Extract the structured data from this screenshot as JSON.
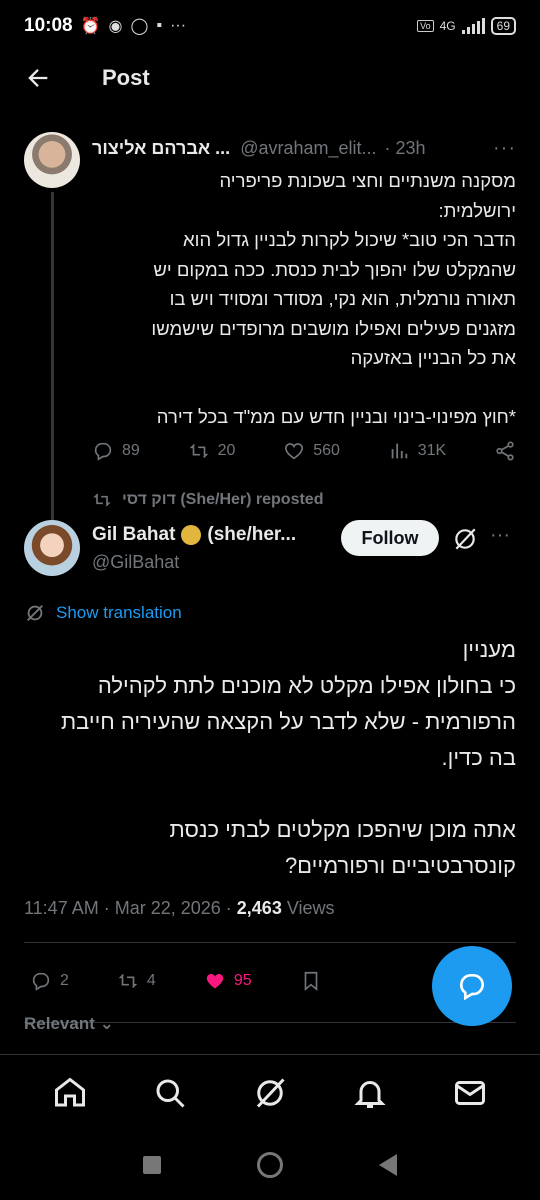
{
  "status_bar": {
    "time": "10:08",
    "network": "4G",
    "battery": "69"
  },
  "header": {
    "title": "Post"
  },
  "original_post": {
    "author_name": "אברהם אליצור ...",
    "handle": "@avraham_elit...",
    "time": "· 23h",
    "lines": [
      "מסקנה משנתיים וחצי בשכונת פריפריה",
      "ירושלמית:",
      "הדבר הכי טוב* שיכול לקרות לבניין גדול הוא",
      "שהמקלט שלו יהפוך לבית כנסת. ככה במקום יש",
      "תאורה נורמלית, הוא נקי, מסודר ומסויד ויש בו",
      "מזגנים פעילים ואפילו מושבים מרופדים שישמשו",
      "את כל הבניין באזעקה"
    ],
    "footnote": "*חוץ מפינוי-בינוי ובניין חדש עם ממ\"ד בכל דירה",
    "replies": "89",
    "reposts": "20",
    "likes": "560",
    "views": "31K"
  },
  "repost_line": {
    "text": "דוק דסי (She/Her) reposted"
  },
  "main_post": {
    "author_name": "Gil Bahat",
    "author_suffix": "(she/her...",
    "handle": "@GilBahat",
    "follow_label": "Follow",
    "show_translation": "Show translation",
    "lines": [
      "מעניין",
      "כי בחולון אפילו מקלט לא מוכנים לתת לקהילה",
      "הרפורמית - שלא לדבר על הקצאה שהעיריה חייבת",
      "בה כדין."
    ],
    "lines2": [
      "אתה מוכן שיהפכו מקלטים לבתי כנסת",
      "קונסרבטיביים ורפורמיים?"
    ],
    "timestamp": "11:47 AM · Mar 22, 2026 · ",
    "views_count": "2,463",
    "views_label": " Views",
    "replies": "2",
    "reposts": "4",
    "likes": "95",
    "like_color": "#f91880"
  },
  "relevant_label": "Relevant",
  "accent_color": "#1d9bf0",
  "bottom_nav": [
    "home-icon",
    "search-icon",
    "grok-icon",
    "notifications-icon",
    "messages-icon"
  ]
}
